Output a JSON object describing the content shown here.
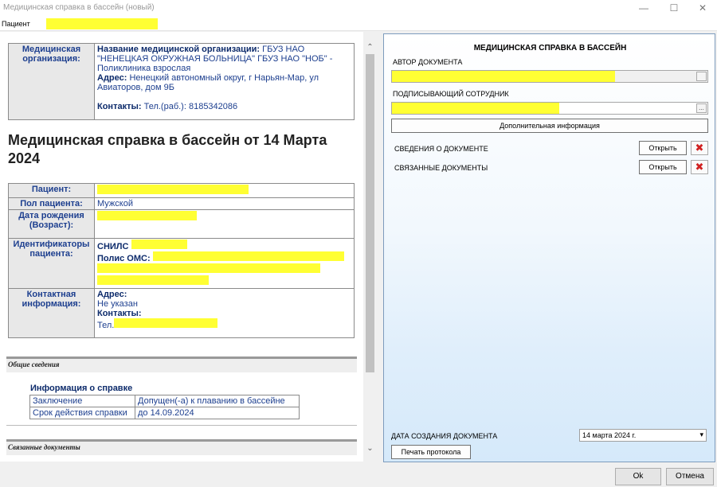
{
  "window": {
    "title": "Медицинская справка в бассейн (новый)",
    "min_glyph": "—",
    "max_glyph": "☐",
    "close_glyph": "✕"
  },
  "patient_bar": {
    "label": "Пациент"
  },
  "org": {
    "label": "Медицинская организация:",
    "name_label": "Название медицинской организации:",
    "name_value": " ГБУЗ НАО \"НЕНЕЦКАЯ ОКРУЖНАЯ БОЛЬНИЦА\" ГБУЗ НАО \"НОБ\" - Поликлиника взрослая",
    "address_label": "Адрес:",
    "address_value": " Ненецкий автономный округ, г Нарьян-Мар, ул Авиаторов, дом 9Б",
    "contacts_label": "Контакты:",
    "contacts_value": " Тел.(раб.): 8185342086"
  },
  "document_title": "Медицинская справка в бассейн от 14 Марта 2024",
  "patient": {
    "patient_label": "Пациент:",
    "gender_label": "Пол пациента:",
    "gender_value": "Мужской",
    "dob_label": "Дата рождения (Возраст):",
    "ids_label": "Идентификаторы пациента:",
    "snils_label": "СНИЛС",
    "oms_label": "Полис ОМС:",
    "contact_label": "Контактная информация:",
    "address_label": "Адрес:",
    "address_value": "Не указан",
    "contacts_label": "Контакты:",
    "phone_prefix": "Тел."
  },
  "sections": {
    "general": "Общие сведения",
    "related": "Связанные документы"
  },
  "certificate": {
    "heading": "Информация о справке",
    "rows": [
      {
        "key": "Заключение",
        "value": "Допущен(-а) к плаванию в бассейне"
      },
      {
        "key": "Срок действия справки",
        "value": "до 14.09.2024"
      }
    ]
  },
  "right_panel": {
    "title": "МЕДИЦИНСКАЯ СПРАВКА В БАССЕЙН",
    "author_label": "АВТОР ДОКУМЕНТА",
    "signer_label": "ПОДПИСЫВАЮЩИЙ СОТРУДНИК",
    "ellipsis": "...",
    "extra_info_button": "Дополнительная информация",
    "doc_info_label": "СВЕДЕНИЯ О ДОКУМЕНТЕ",
    "related_label": "СВЯЗАННЫЕ ДОКУМЕНТЫ",
    "open_button": "Открыть",
    "delete_glyph": "✖",
    "date_label": "ДАТА СОЗДАНИЯ ДОКУМЕНТА",
    "date_value": "14  марта  2024 г.",
    "date_dropdown": "▾",
    "print_button": "Печать протокола"
  },
  "footer": {
    "ok": "Ok",
    "cancel": "Отмена"
  }
}
